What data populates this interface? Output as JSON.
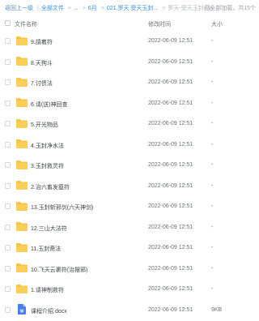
{
  "breadcrumb": {
    "back": "返回上一级",
    "all_files": "全部文件",
    "ellipsis": "...",
    "month": "6月",
    "folder": "021.罗天 受天玉封...",
    "current": "罗天-受天玉封(缺)",
    "status": "已全部加载，共15个"
  },
  "table": {
    "col_name": "文件名称",
    "col_time": "修改时间",
    "col_size": "大小"
  },
  "rows": [
    {
      "name": "9.請着符",
      "time": "2022-06-09 12:51",
      "size": "-",
      "type": "folder"
    },
    {
      "name": "8.天狗斗",
      "time": "2022-06-09 12:51",
      "size": "-",
      "type": "folder"
    },
    {
      "name": "7.讨债法",
      "time": "2022-06-09 12:51",
      "size": "-",
      "type": "folder"
    },
    {
      "name": "6.请(送)神回查",
      "time": "2022-06-09 12:51",
      "size": "-",
      "type": "folder"
    },
    {
      "name": "5.开光物品",
      "time": "2022-06-09 12:51",
      "size": "-",
      "type": "folder"
    },
    {
      "name": "4.玉封净水法",
      "time": "2022-06-09 12:51",
      "size": "-",
      "type": "folder"
    },
    {
      "name": "3.玉封救灵符",
      "time": "2022-06-09 12:51",
      "size": "-",
      "type": "folder"
    },
    {
      "name": "2.治六畜发瘟符",
      "time": "2022-06-09 12:51",
      "size": "-",
      "type": "folder"
    },
    {
      "name": "13.玉封斩邪剑(六天神剑)",
      "time": "2022-06-09 12:51",
      "size": "-",
      "type": "folder"
    },
    {
      "name": "12.三山大法符",
      "time": "2022-06-09 12:51",
      "size": "-",
      "type": "folder"
    },
    {
      "name": "11.玉封斋法",
      "time": "2022-06-09 12:51",
      "size": "-",
      "type": "folder"
    },
    {
      "name": "10.飞天云裹符(治摆邪)",
      "time": "2022-06-09 12:51",
      "size": "-",
      "type": "folder"
    },
    {
      "name": "1.请神制救符",
      "time": "2022-06-09 12:51",
      "size": "-",
      "type": "folder"
    },
    {
      "name": "课程介绍.docx",
      "time": "2022-06-09 12:51",
      "size": "9KB",
      "type": "docx"
    }
  ],
  "colors": {
    "folder": "#f7c443",
    "folder_tab": "#f0b429",
    "docx": "#4a7cf0",
    "link": "#3a8fe0"
  },
  "icons": {
    "folder": "folder-icon",
    "file": "word-doc-icon"
  }
}
